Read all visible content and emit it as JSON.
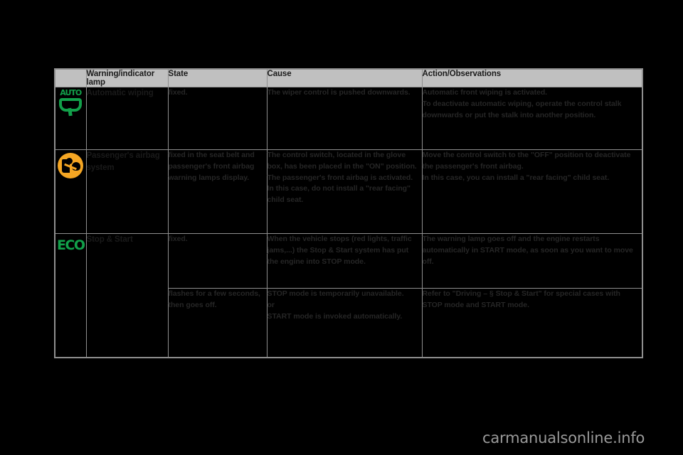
{
  "table": {
    "headers": {
      "icon": "",
      "lamp": "Warning/indicator lamp",
      "state": "State",
      "cause": "Cause",
      "action": "Action/Observations"
    },
    "rows": [
      {
        "icon_name": "automatic-wiping-lamp-icon",
        "icon_text": "AUTO",
        "name": "Automatic wiping",
        "state": "fixed.",
        "cause": "The wiper control is pushed downwards.",
        "action_lines": [
          "Automatic front wiping is activated.",
          "To deactivate automatic wiping, operate the control stalk downwards or put the stalk into another position."
        ]
      },
      {
        "icon_name": "passenger-airbag-lamp-icon",
        "icon_text": "",
        "name": "Passenger's airbag system",
        "state": "fixed in the seat belt and passenger's front airbag warning lamps display.",
        "cause_lines": [
          "The control switch, located in the glove box, has been placed in the \"ON\" position.",
          "The passenger's front airbag is activated.",
          "In this case, do not install a \"rear facing\" child seat."
        ],
        "action_lines": [
          "Move the control switch to the \"OFF\" position to deactivate the passenger's front airbag.",
          "In this case, you can install a \"rear facing\" child seat."
        ]
      },
      {
        "icon_name": "eco-stop-start-lamp-icon",
        "icon_text": "ECO",
        "name": "Stop & Start",
        "sub_rows": [
          {
            "state": "fixed.",
            "cause": "When the vehicle stops (red lights, traffic jams,...) the Stop & Start system has put the engine into STOP mode.",
            "action": "The warning lamp goes off and the engine restarts automatically in START mode, as soon as you want to move off."
          },
          {
            "state": "flashes for a few seconds, then goes off.",
            "cause_lines": [
              "STOP mode is temporarily unavailable.",
              "or",
              "START mode is invoked automatically."
            ],
            "action": "Refer to \"Driving – § Stop & Start\" for special cases with STOP mode and START mode."
          }
        ]
      }
    ]
  },
  "watermark": "carmanualsonline.info",
  "colors": {
    "header_background": "#c0c0c0",
    "name_cell_background": "#dcdcdc",
    "page_background": "#000000",
    "border": "#8f8f8f",
    "green_lamp": "#12a04a",
    "amber_lamp": "#f5a623",
    "body_text": "#262626"
  }
}
